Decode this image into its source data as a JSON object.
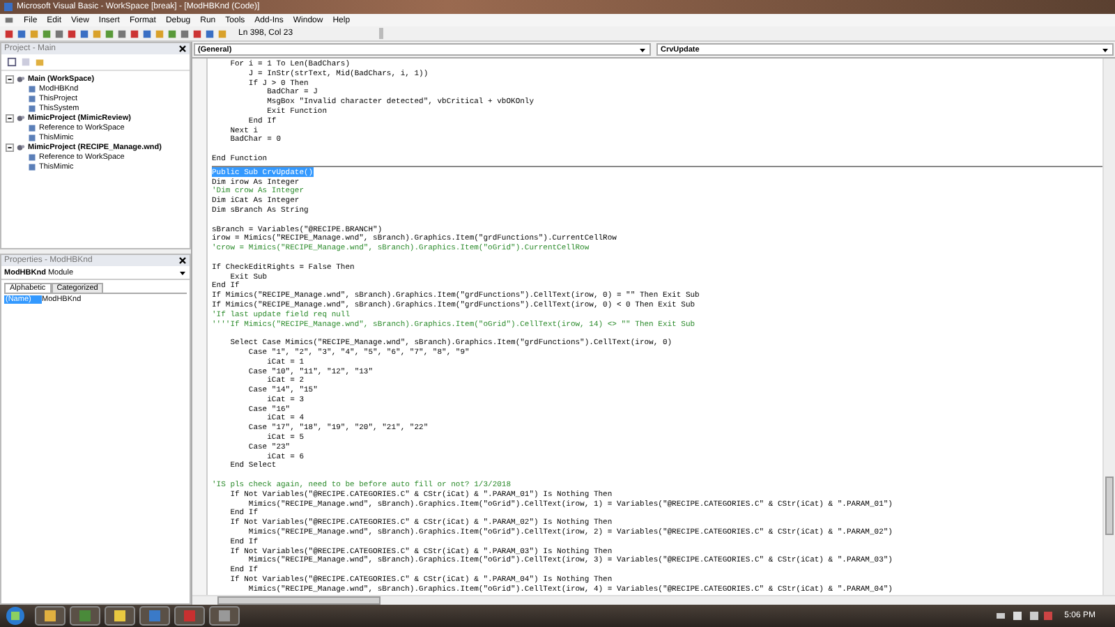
{
  "window": {
    "title": "Microsoft Visual Basic - WorkSpace [break] - [ModHBKnd (Code)]"
  },
  "menu": [
    "File",
    "Edit",
    "View",
    "Insert",
    "Format",
    "Debug",
    "Run",
    "Tools",
    "Add-Ins",
    "Window",
    "Help"
  ],
  "toolbar": {
    "position": "Ln 398, Col 23"
  },
  "project": {
    "title": "Project - Main",
    "tree": [
      {
        "label": "Main (WorkSpace)",
        "expanded": true,
        "children": [
          "ModHBKnd",
          "ThisProject",
          "ThisSystem"
        ]
      },
      {
        "label": "MimicProject (MimicReview)",
        "expanded": true,
        "children": [
          "Reference to WorkSpace",
          "ThisMimic"
        ]
      },
      {
        "label": "MimicProject (RECIPE_Manage.wnd)",
        "expanded": true,
        "children": [
          "Reference to WorkSpace",
          "ThisMimic"
        ]
      }
    ]
  },
  "properties": {
    "title": "Properties - ModHBKnd",
    "object": "ModHBKnd",
    "object_type": "Module",
    "tabs": [
      {
        "label": "Alphabetic",
        "selected": true
      },
      {
        "label": "Categorized",
        "selected": false
      }
    ],
    "rows": [
      {
        "name": "(Name)",
        "value": "ModHBKnd",
        "selected": true
      }
    ]
  },
  "code": {
    "object": "(General)",
    "procedure": "CrvUpdate",
    "procedures": [
      {
        "lines": [
          {
            "kind": "code",
            "text": "    For i = 1 To Len(BadChars)"
          },
          {
            "kind": "code",
            "text": "        J = InStr(strText, Mid(BadChars, i, 1))"
          },
          {
            "kind": "code",
            "text": "        If J > 0 Then"
          },
          {
            "kind": "code",
            "text": "            BadChar = J"
          },
          {
            "kind": "code",
            "text": "            MsgBox \"Invalid character detected\", vbCritical + vbOKOnly"
          },
          {
            "kind": "code",
            "text": "            Exit Function"
          },
          {
            "kind": "code",
            "text": "        End If"
          },
          {
            "kind": "code",
            "text": "    Next i"
          },
          {
            "kind": "code",
            "text": "    BadChar = 0"
          },
          {
            "kind": "blank"
          },
          {
            "kind": "code",
            "text": "End Function"
          }
        ]
      },
      {
        "lines": [
          {
            "kind": "selected",
            "text": "Public Sub CrvUpdate()"
          },
          {
            "kind": "code",
            "text": "Dim irow As Integer"
          },
          {
            "kind": "comment",
            "text": "'Dim crow As Integer"
          },
          {
            "kind": "code",
            "text": "Dim iCat As Integer"
          },
          {
            "kind": "code",
            "text": "Dim sBranch As String"
          },
          {
            "kind": "blank"
          },
          {
            "kind": "code",
            "text": "sBranch = Variables(\"@RECIPE.BRANCH\")"
          },
          {
            "kind": "code",
            "text": "irow = Mimics(\"RECIPE_Manage.wnd\", sBranch).Graphics.Item(\"grdFunctions\").CurrentCellRow"
          },
          {
            "kind": "comment",
            "text": "'crow = Mimics(\"RECIPE_Manage.wnd\", sBranch).Graphics.Item(\"oGrid\").CurrentCellRow"
          },
          {
            "kind": "blank"
          },
          {
            "kind": "code",
            "text": "If CheckEditRights = False Then"
          },
          {
            "kind": "code",
            "text": "    Exit Sub"
          },
          {
            "kind": "code",
            "text": "End If"
          },
          {
            "kind": "code",
            "text": "If Mimics(\"RECIPE_Manage.wnd\", sBranch).Graphics.Item(\"grdFunctions\").CellText(irow, 0) = \"\" Then Exit Sub"
          },
          {
            "kind": "code",
            "text": "If Mimics(\"RECIPE_Manage.wnd\", sBranch).Graphics.Item(\"grdFunctions\").CellText(irow, 0) < 0 Then Exit Sub"
          },
          {
            "kind": "comment",
            "text": "'If last update field req null"
          },
          {
            "kind": "comment",
            "text": "''''If Mimics(\"RECIPE_Manage.wnd\", sBranch).Graphics.Item(\"oGrid\").CellText(irow, 14) <> \"\" Then Exit Sub"
          },
          {
            "kind": "blank"
          },
          {
            "kind": "code",
            "text": "    Select Case Mimics(\"RECIPE_Manage.wnd\", sBranch).Graphics.Item(\"grdFunctions\").CellText(irow, 0)"
          },
          {
            "kind": "code",
            "text": "        Case \"1\", \"2\", \"3\", \"4\", \"5\", \"6\", \"7\", \"8\", \"9\""
          },
          {
            "kind": "code",
            "text": "            iCat = 1"
          },
          {
            "kind": "code",
            "text": "        Case \"10\", \"11\", \"12\", \"13\""
          },
          {
            "kind": "code",
            "text": "            iCat = 2"
          },
          {
            "kind": "code",
            "text": "        Case \"14\", \"15\""
          },
          {
            "kind": "code",
            "text": "            iCat = 3"
          },
          {
            "kind": "code",
            "text": "        Case \"16\""
          },
          {
            "kind": "code",
            "text": "            iCat = 4"
          },
          {
            "kind": "code",
            "text": "        Case \"17\", \"18\", \"19\", \"20\", \"21\", \"22\""
          },
          {
            "kind": "code",
            "text": "            iCat = 5"
          },
          {
            "kind": "code",
            "text": "        Case \"23\""
          },
          {
            "kind": "code",
            "text": "            iCat = 6"
          },
          {
            "kind": "code",
            "text": "    End Select"
          },
          {
            "kind": "blank"
          },
          {
            "kind": "comment",
            "text": "'IS pls check again, need to be before auto fill or not? 1/3/2018"
          },
          {
            "kind": "code",
            "text": "    If Not Variables(\"@RECIPE.CATEGORIES.C\" & CStr(iCat) & \".PARAM_01\") Is Nothing Then"
          },
          {
            "kind": "code",
            "text": "        Mimics(\"RECIPE_Manage.wnd\", sBranch).Graphics.Item(\"oGrid\").CellText(irow, 1) = Variables(\"@RECIPE.CATEGORIES.C\" & CStr(iCat) & \".PARAM_01\")"
          },
          {
            "kind": "code",
            "text": "    End If"
          },
          {
            "kind": "code",
            "text": "    If Not Variables(\"@RECIPE.CATEGORIES.C\" & CStr(iCat) & \".PARAM_02\") Is Nothing Then"
          },
          {
            "kind": "code",
            "text": "        Mimics(\"RECIPE_Manage.wnd\", sBranch).Graphics.Item(\"oGrid\").CellText(irow, 2) = Variables(\"@RECIPE.CATEGORIES.C\" & CStr(iCat) & \".PARAM_02\")"
          },
          {
            "kind": "code",
            "text": "    End If"
          },
          {
            "kind": "code",
            "text": "    If Not Variables(\"@RECIPE.CATEGORIES.C\" & CStr(iCat) & \".PARAM_03\") Is Nothing Then"
          },
          {
            "kind": "code",
            "text": "        Mimics(\"RECIPE_Manage.wnd\", sBranch).Graphics.Item(\"oGrid\").CellText(irow, 3) = Variables(\"@RECIPE.CATEGORIES.C\" & CStr(iCat) & \".PARAM_03\")"
          },
          {
            "kind": "code",
            "text": "    End If"
          },
          {
            "kind": "code",
            "text": "    If Not Variables(\"@RECIPE.CATEGORIES.C\" & CStr(iCat) & \".PARAM_04\") Is Nothing Then"
          },
          {
            "kind": "code",
            "text": "        Mimics(\"RECIPE_Manage.wnd\", sBranch).Graphics.Item(\"oGrid\").CellText(irow, 4) = Variables(\"@RECIPE.CATEGORIES.C\" & CStr(iCat) & \".PARAM_04\")"
          }
        ]
      }
    ]
  },
  "taskbar": {
    "clock": "5:06 PM"
  }
}
